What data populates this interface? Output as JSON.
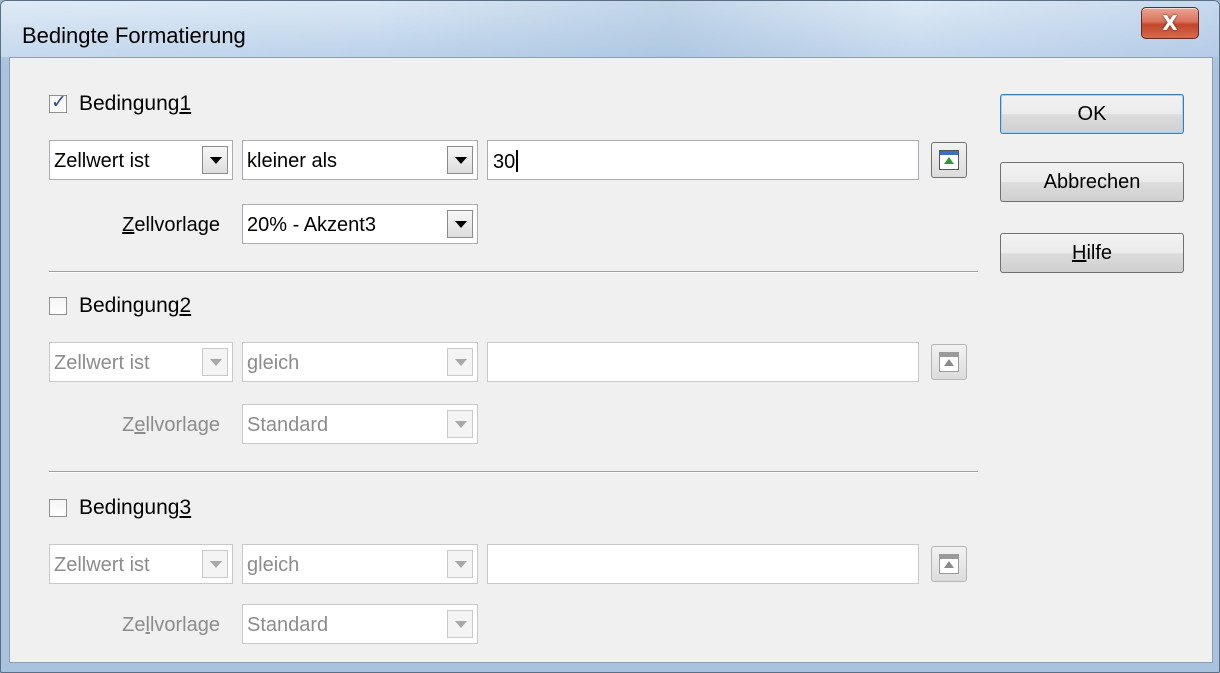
{
  "window": {
    "title": "Bedingte Formatierung",
    "close_label": "X"
  },
  "conditions": [
    {
      "header_prefix": "Bedingung ",
      "header_number": "1",
      "checked": true,
      "type_value": "Zellwert ist",
      "operator_value": "kleiner als",
      "text_value": "30",
      "style_label_a": "",
      "style_label_u": "Z",
      "style_label_b": "ellvorlage",
      "style_value": "20% - Akzent3"
    },
    {
      "header_prefix": "Bedingung ",
      "header_number": "2",
      "checked": false,
      "type_value": "Zellwert ist",
      "operator_value": "gleich",
      "text_value": "",
      "style_label_a": "Z",
      "style_label_u": "e",
      "style_label_b": "llvorlage",
      "style_value": "Standard"
    },
    {
      "header_prefix": "Bedingung ",
      "header_number": "3",
      "checked": false,
      "type_value": "Zellwert ist",
      "operator_value": "gleich",
      "text_value": "",
      "style_label_a": "Ze",
      "style_label_u": "l",
      "style_label_b": "lvorlage",
      "style_value": "Standard"
    }
  ],
  "buttons": {
    "ok": "OK",
    "cancel": "Abbrechen",
    "help_u": "H",
    "help_rest": "ilfe"
  },
  "icons": {
    "shrink": "shrink-dialog-icon",
    "dropdown": "chevron-down-icon",
    "close": "close-icon",
    "checkbox_checked": "checkmark-icon"
  }
}
